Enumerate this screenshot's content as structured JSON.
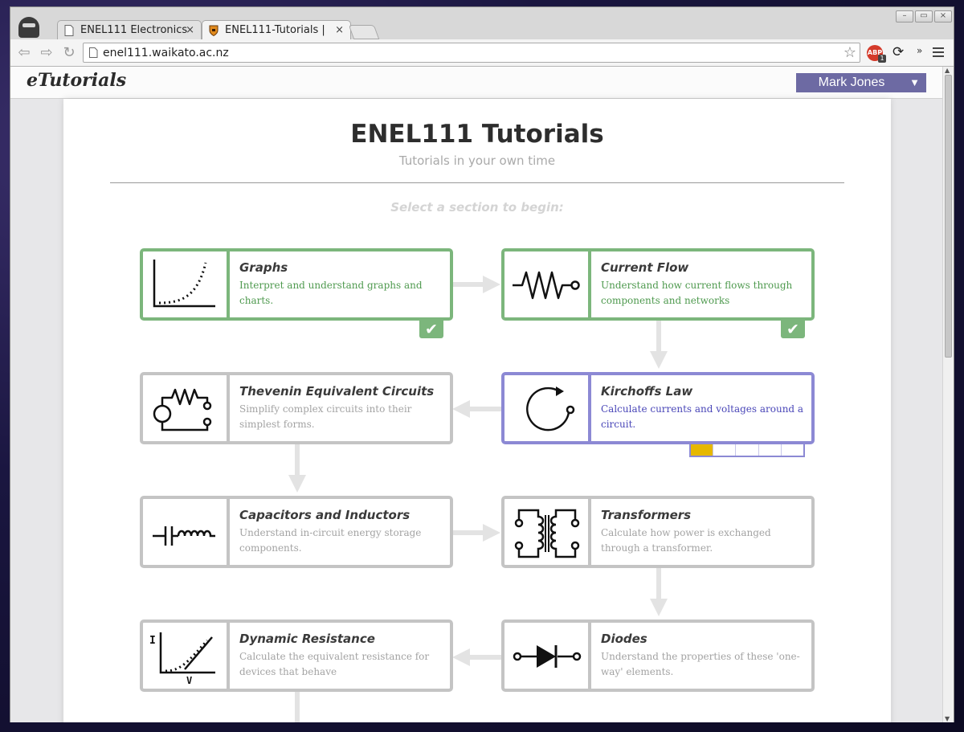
{
  "browser": {
    "tabs": [
      {
        "label": "ENEL111 Electronics",
        "close": "×"
      },
      {
        "label": "ENEL111-Tutorials |",
        "close": "×"
      }
    ],
    "address": "enel111.waikato.ac.nz",
    "abp_label": "ABP",
    "abp_count": "1",
    "window_buttons": {
      "minimize": "–",
      "restore": "▭",
      "close": "×"
    }
  },
  "site": {
    "brand": "eTutorials",
    "user_name": "Mark Jones",
    "user_caret": "▼"
  },
  "page": {
    "title": "ENEL111 Tutorials",
    "subtitle": "Tutorials in your own time",
    "prompt": "Select a section to begin:"
  },
  "sections": [
    {
      "title": "Graphs",
      "desc": "Interpret and understand graphs and charts.",
      "status": "complete",
      "icon": "graph-icon"
    },
    {
      "title": "Current Flow",
      "desc": "Understand how current flows through components and networks",
      "status": "complete",
      "icon": "resistor-icon"
    },
    {
      "title": "Thevenin Equivalent Circuits",
      "desc": "Simplify complex circuits into their simplest forms.",
      "status": "locked",
      "icon": "circuit-icon"
    },
    {
      "title": "Kirchoffs Law",
      "desc": "Calculate currents and voltages around a circuit.",
      "status": "in-progress",
      "icon": "loop-icon",
      "progress": 0.2
    },
    {
      "title": "Capacitors and Inductors",
      "desc": "Understand in-circuit energy storage components.",
      "status": "locked",
      "icon": "capacitor-inductor-icon"
    },
    {
      "title": "Transformers",
      "desc": "Calculate how power is exchanged through a transformer.",
      "status": "locked",
      "icon": "transformer-icon"
    },
    {
      "title": "Dynamic Resistance",
      "desc": "Calculate the equivalent resistance for devices that behave",
      "status": "locked",
      "icon": "iv-curve-icon"
    },
    {
      "title": "Diodes",
      "desc": "Understand the properties of these 'one-way' elements.",
      "status": "locked",
      "icon": "diode-icon"
    }
  ],
  "check_glyph": "✔",
  "icon_labels": {
    "current": "I",
    "voltage": "V"
  },
  "colors": {
    "complete": "#7cb67c",
    "in_progress": "#8c89d4",
    "locked": "#c4c4c4",
    "progress_fill": "#e6b800",
    "user_menu": "#6d6aa3"
  }
}
